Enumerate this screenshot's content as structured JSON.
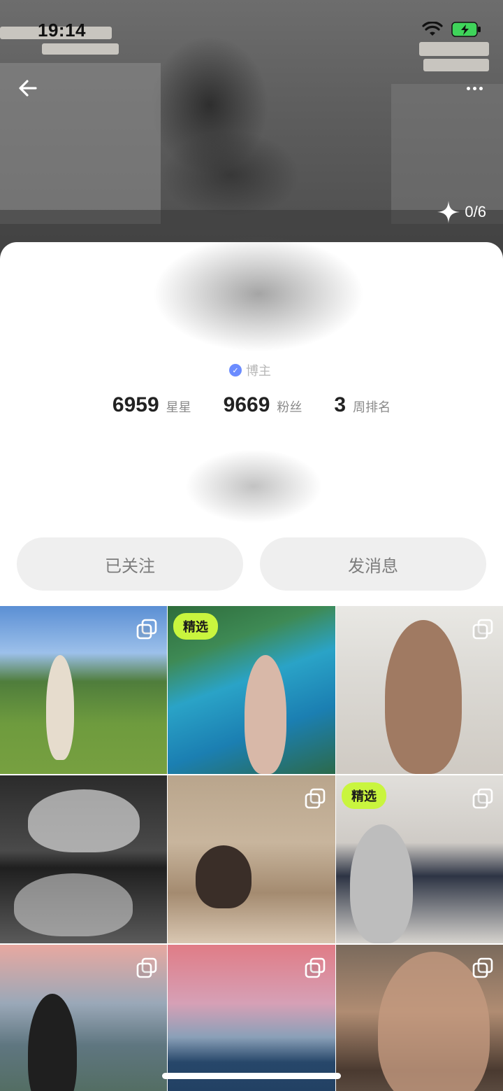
{
  "status_bar": {
    "time": "19:14"
  },
  "header": {
    "back_icon": "arrow-left-icon",
    "more_icon": "more-dots-icon",
    "sparkle_count": "0/6"
  },
  "profile": {
    "role": "博主",
    "stats": [
      {
        "value": "6959",
        "label": "星星"
      },
      {
        "value": "9669",
        "label": "粉丝"
      },
      {
        "value": "3",
        "label": "周排名"
      }
    ],
    "follow_button": "已关注",
    "message_button": "发消息"
  },
  "grid": {
    "badge_label": "精选",
    "items": [
      {
        "badge": false,
        "multi": true
      },
      {
        "badge": true,
        "multi": false
      },
      {
        "badge": false,
        "multi": true
      },
      {
        "badge": false,
        "multi": false
      },
      {
        "badge": false,
        "multi": true
      },
      {
        "badge": true,
        "multi": true
      },
      {
        "badge": false,
        "multi": true
      },
      {
        "badge": false,
        "multi": true
      },
      {
        "badge": false,
        "multi": true
      }
    ]
  },
  "colors": {
    "badge_bg": "#c9f53e",
    "button_bg": "#efefef",
    "button_text": "#7c7c7c",
    "verified": "#6b8cff"
  }
}
